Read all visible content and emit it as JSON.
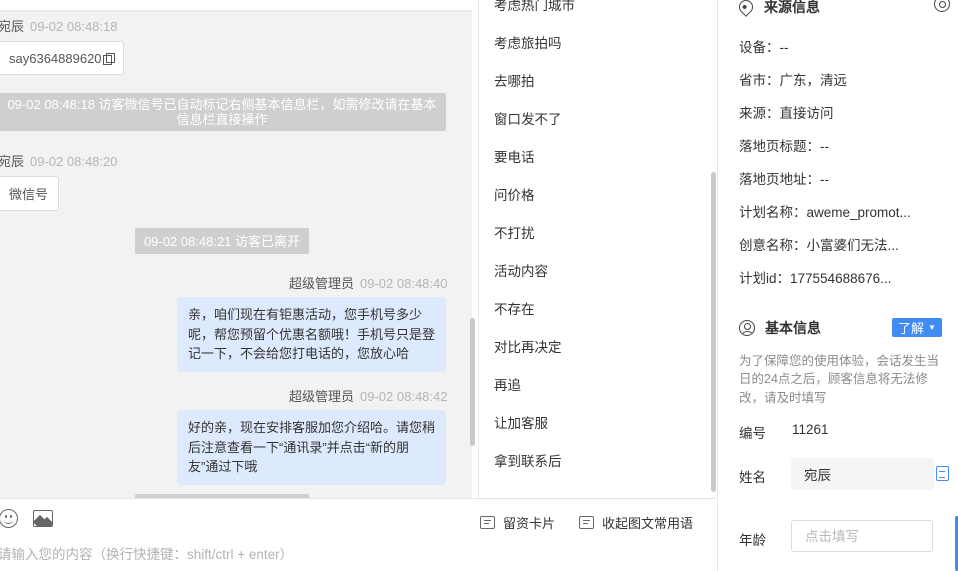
{
  "chat": {
    "messages": [
      {
        "sender": "宛辰",
        "time": "09-02 08:48:18",
        "content": "say6364889620"
      },
      {
        "system": "09-02 08:48:18 访客微信号已自动标记右侧基本信息栏，如需修改请在基本信息栏直接操作"
      },
      {
        "sender": "宛辰",
        "time": "09-02 08:48:20",
        "content": "微信号"
      },
      {
        "system": "09-02 08:48:21 访客已离开"
      },
      {
        "sender": "超级管理员",
        "time": "09-02 08:48:40",
        "content": "亲，咱们现在有钜惠活动，您手机号多少呢，帮您预留个优惠名额哦！手机号只是登记一下，不会给您打电话的，您放心哈"
      },
      {
        "sender": "超级管理员",
        "time": "09-02 08:48:42",
        "content": "好的亲，现在安排客服加您介绍哈。请您稍后注意查看一下“通讯录”并点击“新的朋友”通过下哦"
      }
    ]
  },
  "composer": {
    "resume_card_label": "留资卡片",
    "collapse_phrases_label": "收起图文常用语",
    "placeholder": "请输入您的内容（换行快捷键：shift/ctrl + enter）",
    "emoji_icon": "emoji-icon",
    "image_icon": "image-icon"
  },
  "quick_replies": {
    "items": [
      "考虑热门城市",
      "考虑旅拍吗",
      "去哪拍",
      "窗口发不了",
      "要电话",
      "问价格",
      "不打扰",
      "活动内容",
      "不存在",
      "对比再决定",
      "再追",
      "让加客服",
      "拿到联系后"
    ]
  },
  "info": {
    "source": {
      "title": "来源信息",
      "rows": [
        {
          "label": "设备：",
          "value": "--"
        },
        {
          "label": "省市：",
          "value": "广东，清远"
        },
        {
          "label": "来源：",
          "value": "直接访问"
        },
        {
          "label": "落地页标题：",
          "value": "--"
        },
        {
          "label": "落地页地址：",
          "value": "--"
        },
        {
          "label": "计划名称：",
          "value": "aweme_promot..."
        },
        {
          "label": "创意名称：",
          "value": "小富婆们无法..."
        },
        {
          "label": "计划id：",
          "value": "177554688676..."
        }
      ]
    },
    "basic": {
      "title": "基本信息",
      "learn_more": "了解",
      "note": "为了保障您的使用体验，会话发生当日的24点之后，顾客信息将无法修改，请及时填写",
      "id_label": "编号",
      "id_value": "11261",
      "name_label": "姓名",
      "name_value": "宛辰",
      "age_label": "年龄",
      "age_placeholder": "点击填写"
    },
    "accent_color": "#3f8cf7"
  }
}
